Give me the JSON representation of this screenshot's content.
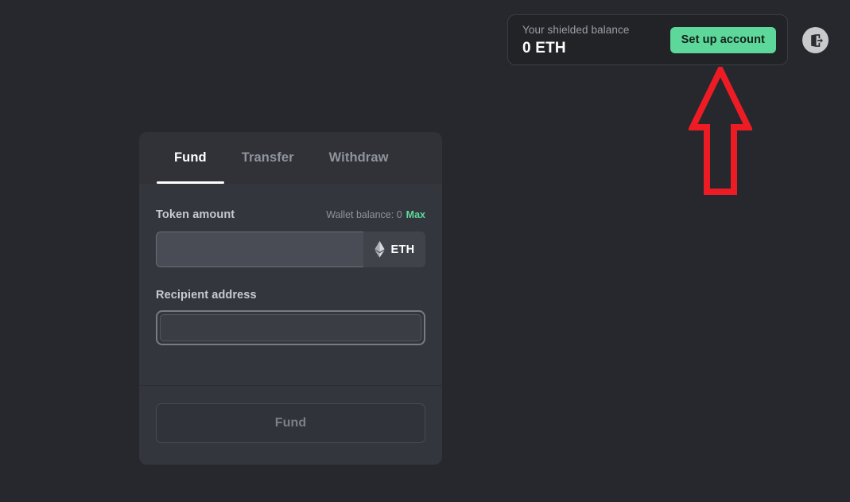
{
  "topbar": {
    "balance_label": "Your shielded balance",
    "balance_value": "0 ETH",
    "setup_button": "Set up account",
    "logout_icon": "logout-icon",
    "accent_green": "#5dd89a",
    "card_bg": "#212327"
  },
  "annotation": {
    "shape": "up-arrow",
    "color": "#ed1c24"
  },
  "card": {
    "tabs": [
      {
        "label": "Fund",
        "active": true
      },
      {
        "label": "Transfer",
        "active": false
      },
      {
        "label": "Withdraw",
        "active": false
      }
    ],
    "amount": {
      "label": "Token amount",
      "wallet_balance_text": "Wallet balance: 0",
      "max_label": "Max",
      "input_value": "",
      "input_placeholder": "",
      "token_symbol": "ETH",
      "token_icon": "ethereum-icon"
    },
    "recipient": {
      "label": "Recipient address",
      "input_value": "",
      "input_placeholder": ""
    },
    "submit": {
      "label": "Fund",
      "disabled": true
    }
  },
  "page": {
    "background": "#26282d"
  }
}
